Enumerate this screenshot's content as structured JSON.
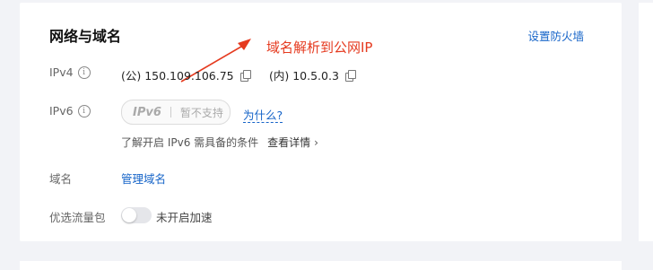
{
  "header": {
    "title": "网络与域名",
    "firewall_link": "设置防火墙"
  },
  "annotation": {
    "text": "域名解析到公网IP",
    "color": "#e53a1f"
  },
  "rows": {
    "ipv4": {
      "label": "IPv4",
      "public_ip": "(公) 150.109.106.75",
      "private_ip": "(内) 10.5.0.3"
    },
    "ipv6": {
      "label": "IPv6",
      "logo_text": "IPv6",
      "status": "暂不支持",
      "why_link": "为什么?",
      "note": "了解开启 IPv6 需具备的条件",
      "detail_link": "查看详情"
    },
    "domain": {
      "label": "域名",
      "manage_link": "管理域名"
    },
    "traffic": {
      "label": "优选流量包",
      "toggle_on": false,
      "toggle_text": "未开启加速"
    }
  },
  "colors": {
    "link": "#1664c8",
    "background": "#f2f3f7"
  }
}
